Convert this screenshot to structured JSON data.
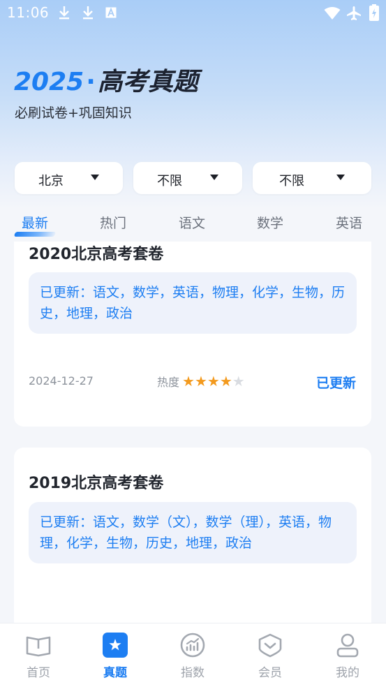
{
  "status_bar": {
    "time": "11:06",
    "icons": [
      "download-icon",
      "download-icon",
      "font-icon",
      "wifi-icon",
      "airplane-icon",
      "battery-icon"
    ]
  },
  "header": {
    "year": "2025",
    "dot": "·",
    "title": "高考真题",
    "subtitle": "必刷试卷+巩固知识"
  },
  "filters": [
    {
      "label": "北京"
    },
    {
      "label": "不限"
    },
    {
      "label": "不限"
    }
  ],
  "tabs": [
    {
      "label": "最新",
      "active": true
    },
    {
      "label": "热门"
    },
    {
      "label": "语文"
    },
    {
      "label": "数学"
    },
    {
      "label": "英语"
    }
  ],
  "papers": [
    {
      "title": "2020北京高考套卷",
      "updated": "已更新：语文，数学，英语，物理，化学，生物，历史，地理，政治",
      "date": "2024-12-27",
      "heat_label": "热度",
      "heat_rating": 4,
      "heat_max": 5,
      "status": "已更新"
    },
    {
      "title": "2019北京高考套卷",
      "updated": "已更新：语文，数学（文），数学（理），英语，物理，化学，生物，历史，地理，政治"
    }
  ],
  "bottom_nav": [
    {
      "label": "首页",
      "icon": "book-icon"
    },
    {
      "label": "真题",
      "icon": "star-icon",
      "active": true
    },
    {
      "label": "指数",
      "icon": "chart-icon"
    },
    {
      "label": "会员",
      "icon": "vip-icon"
    },
    {
      "label": "我的",
      "icon": "user-icon"
    }
  ],
  "colors": {
    "accent": "#1d7ef2",
    "star": "#f39a1e",
    "tag_bg": "#eef2fb"
  }
}
